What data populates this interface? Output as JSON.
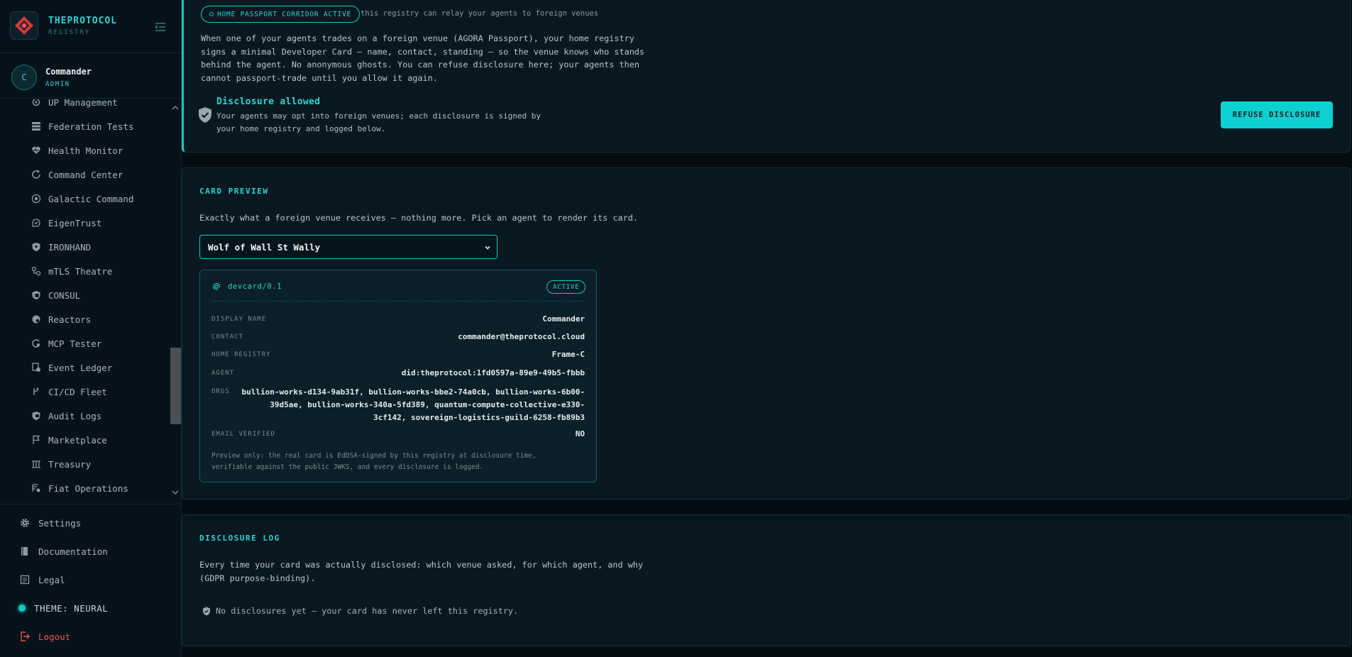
{
  "brand": {
    "name": "THEPROTOCOL",
    "sub": "REGISTRY"
  },
  "user": {
    "initial": "C",
    "name": "Commander",
    "role": "ADMIN"
  },
  "nav": {
    "items": [
      {
        "label": "UP Management",
        "icon": "user-gear-icon"
      },
      {
        "label": "Federation Tests",
        "icon": "server-icon"
      },
      {
        "label": "Health Monitor",
        "icon": "heart-pulse-icon"
      },
      {
        "label": "Command Center",
        "icon": "sync-icon"
      },
      {
        "label": "Galactic Command",
        "icon": "target-icon"
      },
      {
        "label": "EigenTrust",
        "icon": "trust-icon"
      },
      {
        "label": "IRONHAND",
        "icon": "shield-icon"
      },
      {
        "label": "mTLS Theatre",
        "icon": "link-icon"
      },
      {
        "label": "CONSUL",
        "icon": "consul-icon"
      },
      {
        "label": "Reactors",
        "icon": "reactor-icon"
      },
      {
        "label": "MCP Tester",
        "icon": "plug-icon"
      },
      {
        "label": "Event Ledger",
        "icon": "ledger-icon"
      },
      {
        "label": "CI/CD Fleet",
        "icon": "branch-icon"
      },
      {
        "label": "Audit Logs",
        "icon": "audit-icon"
      },
      {
        "label": "Marketplace",
        "icon": "flag-icon"
      },
      {
        "label": "Treasury",
        "icon": "treasury-icon"
      },
      {
        "label": "Fiat Operations",
        "icon": "fiat-icon"
      }
    ]
  },
  "bottom": {
    "settings": "Settings",
    "docs": "Documentation",
    "legal": "Legal",
    "theme": "THEME: NEURAL",
    "logout": "Logout"
  },
  "passport": {
    "pill": "HOME PASSPORT CORRIDOR ACTIVE",
    "note": "this registry can relay your agents to foreign venues",
    "intro": "When one of your agents trades on a foreign venue (AGORA Passport), your home registry signs a minimal Developer Card — name, contact, standing — so the venue knows who stands behind the agent. No anonymous ghosts. You can refuse disclosure here; your agents then cannot passport-trade until you allow it again.",
    "status_title": "Disclosure allowed",
    "status_desc": "Your agents may opt into foreign venues; each disclosure is signed by your home registry and logged below.",
    "refuse_label": "REFUSE DISCLOSURE"
  },
  "preview": {
    "title": "CARD PREVIEW",
    "desc": "Exactly what a foreign venue receives — nothing more. Pick an agent to render its card.",
    "selected_agent": "Wolf of Wall St Wally",
    "card": {
      "proto": "devcard/0.1",
      "badge": "ACTIVE",
      "rows": {
        "display_name_label": "DISPLAY NAME",
        "display_name": "Commander",
        "contact_label": "CONTACT",
        "contact": "commander@theprotocol.cloud",
        "home_label": "HOME REGISTRY",
        "home": "Frame-C",
        "agent_label": "AGENT",
        "agent": "did:theprotocol:1fd0597a-89e9-49b5-fbbb",
        "orgs_label": "ORGS",
        "orgs": "bullion-works-d134-9ab31f, bullion-works-bbe2-74a0cb, bullion-works-6b00-39d5ae, bullion-works-340a-5fd389, quantum-compute-collective-e330-3cf142, sovereign-logistics-guild-6258-fb89b3",
        "email_label": "EMAIL VERIFIED",
        "email": "NO"
      },
      "note": "Preview only: the real card is EdDSA-signed by this registry at disclosure time, verifiable against the public JWKS, and every disclosure is logged."
    }
  },
  "log": {
    "title": "DISCLOSURE LOG",
    "desc": "Every time your card was actually disclosed: which venue asked, for which agent, and why (GDPR purpose-binding).",
    "empty": "No disclosures yet — your card has never left this registry."
  },
  "colors": {
    "accent": "#18c7c4",
    "danger": "#e2554e",
    "logo": "#d8353a"
  }
}
